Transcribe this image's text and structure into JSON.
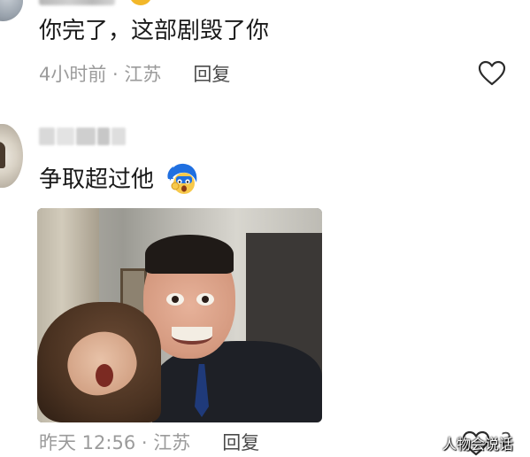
{
  "comments": [
    {
      "text": "你完了，这部剧毁了你",
      "meta": {
        "time_location": "4小时前 · 江苏",
        "reply_label": "回复"
      }
    },
    {
      "text": "争取超过他",
      "image": {
        "description": "meme screenshot"
      },
      "meta": {
        "time_location": "昨天 12:56 · 江苏",
        "reply_label": "回复",
        "like_count": "2"
      }
    }
  ],
  "watermark": "人物会说话",
  "icons": {
    "like": "heart-outline-icon",
    "emoji": "shocked-face-emoji-icon"
  },
  "colors": {
    "meta_text": "#9b9b9b",
    "reply_text": "#4a4a4a",
    "body_text": "#1a1a1a"
  }
}
